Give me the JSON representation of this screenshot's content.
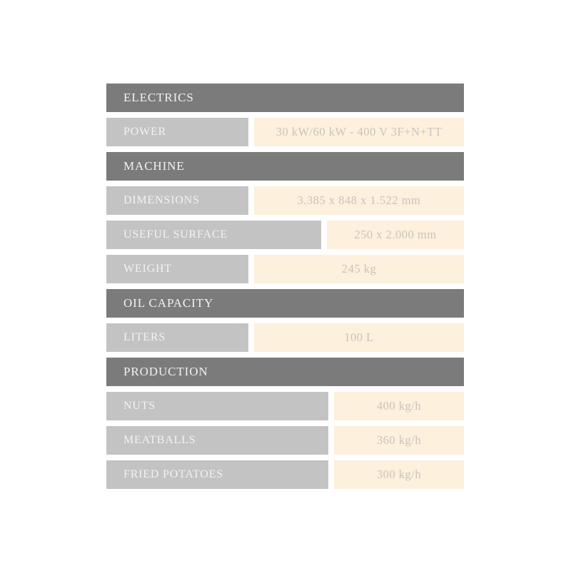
{
  "table": {
    "sections": [
      {
        "id": "electrics",
        "title": "ELECTRICS",
        "rows": [
          {
            "label": "POWER",
            "value": "30 kW/60 kW - 400 V 3F+N+TT",
            "split": "standard"
          }
        ]
      },
      {
        "id": "machine",
        "title": "MACHINE",
        "rows": [
          {
            "label": "DIMENSIONS",
            "value": "3.385 x 848 x 1.522 mm",
            "split": "standard"
          },
          {
            "label": "USEFUL SURFACE",
            "value": "250 x 2.000 mm",
            "split": "wide"
          },
          {
            "label": "WEIGHT",
            "value": "245 kg",
            "split": "standard"
          }
        ]
      },
      {
        "id": "oil-capacity",
        "title": "OIL CAPACITY",
        "rows": [
          {
            "label": "LITERS",
            "value": "100 L",
            "split": "standard"
          }
        ]
      },
      {
        "id": "production",
        "title": "PRODUCTION",
        "rows": [
          {
            "label": "NUTS",
            "value": "400 kg/h",
            "split": "widest"
          },
          {
            "label": "MEATBALLS",
            "value": "360 kg/h",
            "split": "widest"
          },
          {
            "label": "FRIED POTATOES",
            "value": "300 kg/h",
            "split": "widest"
          }
        ]
      }
    ]
  },
  "colors": {
    "section_header_bg": "#7b7b7b",
    "label_bg": "#c3c3c3",
    "value_bg": "#fdf0dc",
    "label_text": "#f2f2f2",
    "value_text": "#c8c4be",
    "page_bg": "#ffffff"
  }
}
